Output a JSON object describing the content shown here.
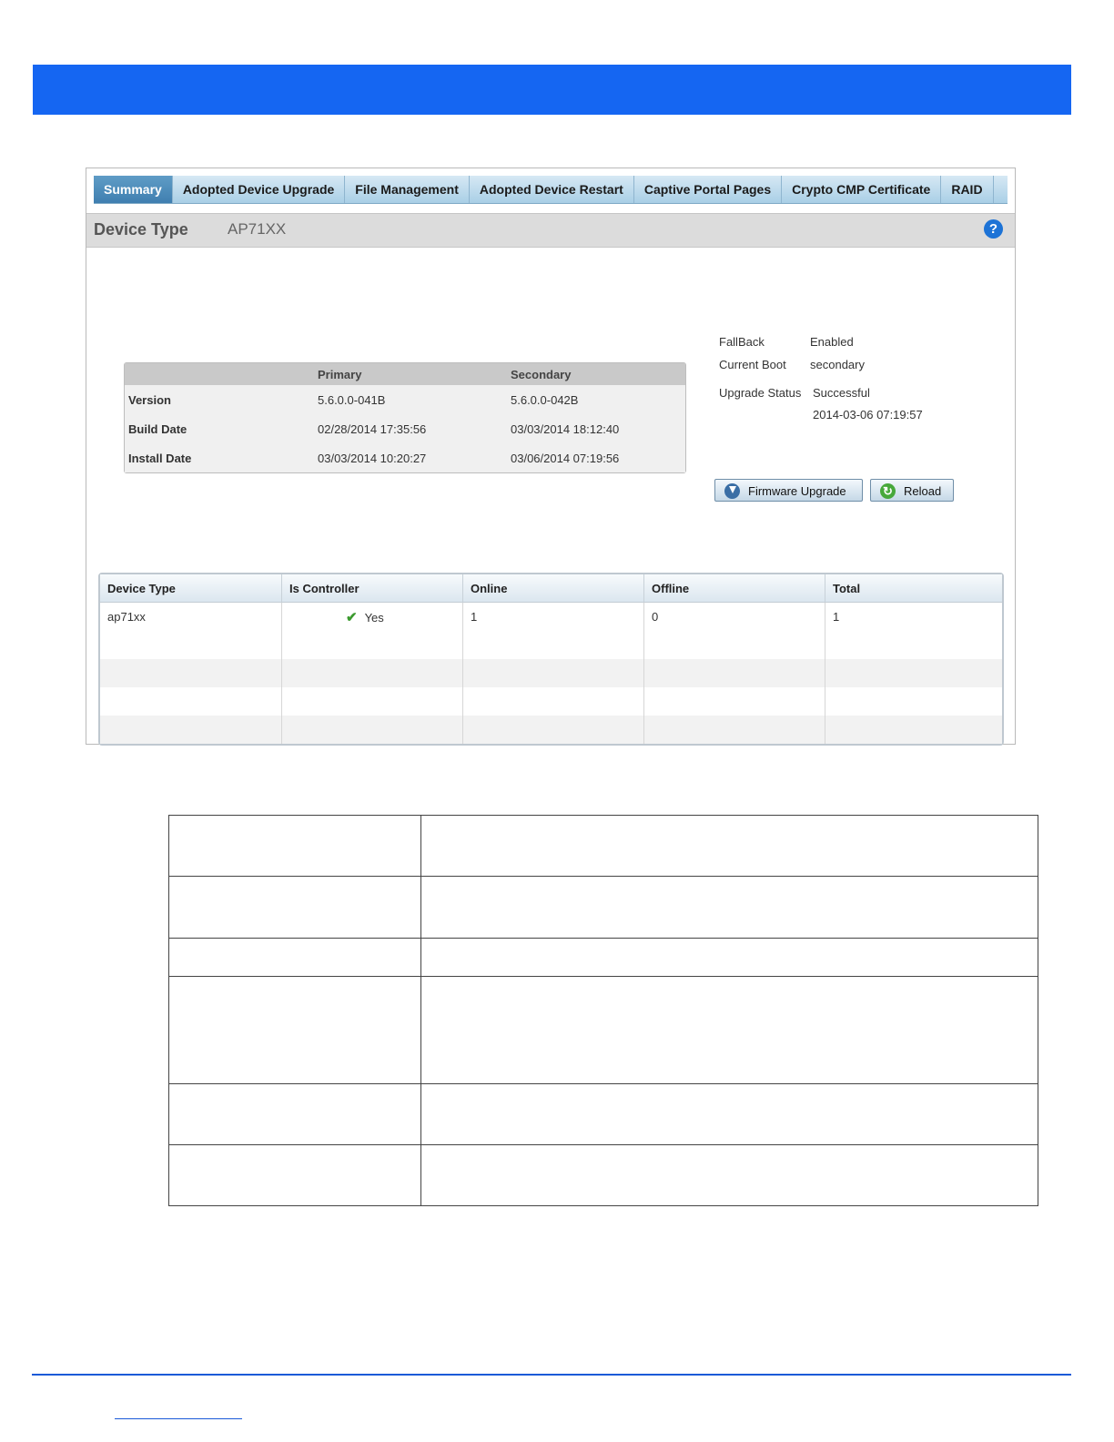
{
  "tabs": [
    "Summary",
    "Adopted Device Upgrade",
    "File Management",
    "Adopted Device Restart",
    "Captive Portal Pages",
    "Crypto CMP Certificate",
    "RAID"
  ],
  "header": {
    "label": "Device Type",
    "value": "AP71XX",
    "help_icon": "?"
  },
  "firmware_table": {
    "columns": [
      "",
      "Primary",
      "Secondary"
    ],
    "rows": [
      {
        "label": "Version",
        "primary": "5.6.0.0-041B",
        "secondary": "5.6.0.0-042B"
      },
      {
        "label": "Build Date",
        "primary": "02/28/2014 17:35:56",
        "secondary": "03/03/2014 18:12:40"
      },
      {
        "label": "Install Date",
        "primary": "03/03/2014 10:20:27",
        "secondary": "03/06/2014 07:19:56"
      }
    ]
  },
  "status": {
    "fallback_label": "FallBack",
    "fallback_value": "Enabled",
    "boot_label": "Current Boot",
    "boot_value": "secondary",
    "upgrade_label": "Upgrade Status",
    "upgrade_value": "Successful",
    "upgrade_time": "2014-03-06 07:19:57"
  },
  "buttons": {
    "firmware_upgrade": "Firmware Upgrade",
    "reload": "Reload"
  },
  "device_table": {
    "columns": [
      "Device Type",
      "Is Controller",
      "Online",
      "Offline",
      "Total"
    ],
    "rows": [
      {
        "device_type": "ap71xx",
        "is_controller": "Yes",
        "online": "1",
        "offline": "0",
        "total": "1"
      }
    ]
  },
  "colors": {
    "banner": "#1566f2",
    "tab_active": "#3f7fb0",
    "help": "#1d73d6",
    "check": "#3b9a2e"
  }
}
